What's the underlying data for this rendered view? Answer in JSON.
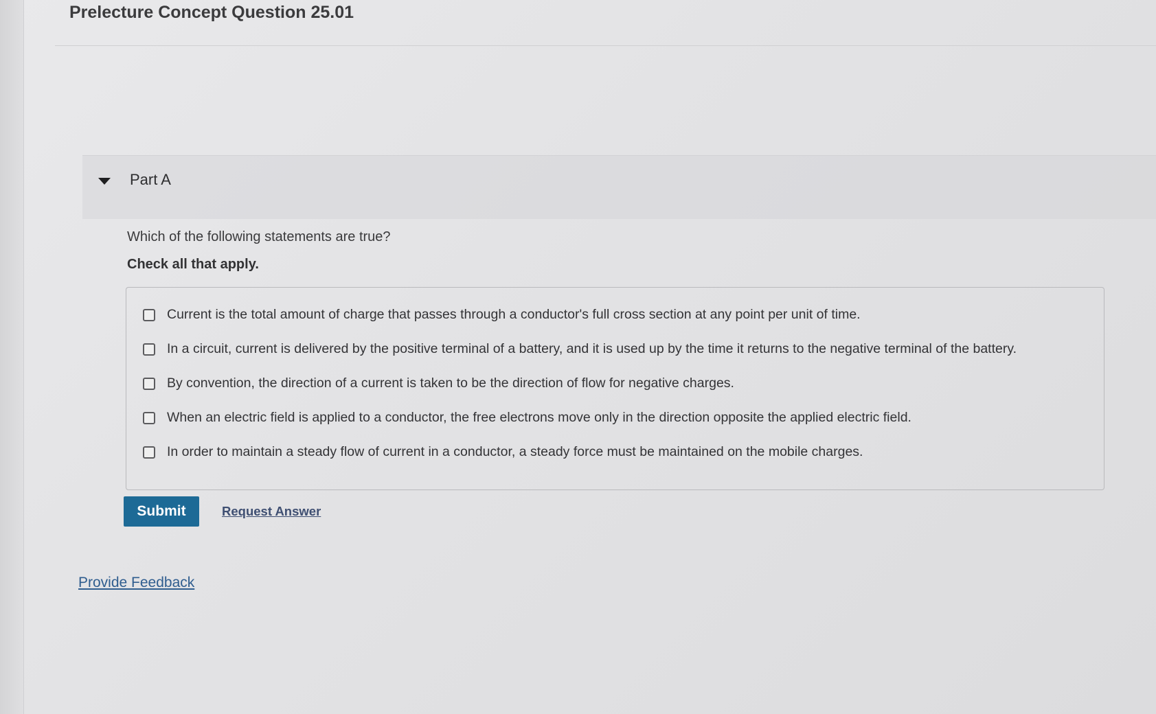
{
  "page": {
    "title": "Prelecture Concept Question 25.01"
  },
  "part": {
    "label": "Part A",
    "question": "Which of the following statements are true?",
    "instruction": "Check all that apply.",
    "options": [
      {
        "label": "Current is the total amount of charge that passes through a conductor's full cross section at any point per unit of time.",
        "checked": false
      },
      {
        "label": "In a circuit, current is delivered by the positive terminal of a battery, and it is used up by the time it returns to the negative terminal of the battery.",
        "checked": false
      },
      {
        "label": "By convention, the direction of a current is taken to be the direction of flow for negative charges.",
        "checked": false
      },
      {
        "label": "When an electric field is applied to a conductor, the free electrons move only in the direction opposite the applied electric field.",
        "checked": false
      },
      {
        "label": "In order to maintain a steady flow of current in a conductor, a steady force must be maintained on the mobile charges.",
        "checked": false
      }
    ]
  },
  "actions": {
    "submit_label": "Submit",
    "request_answer_label": "Request Answer"
  },
  "footer": {
    "feedback_label": "Provide Feedback"
  },
  "colors": {
    "submit_bg": "#1d6a96",
    "link": "#2f5d8f"
  },
  "icons": {
    "collapse": "caret-down-icon"
  }
}
